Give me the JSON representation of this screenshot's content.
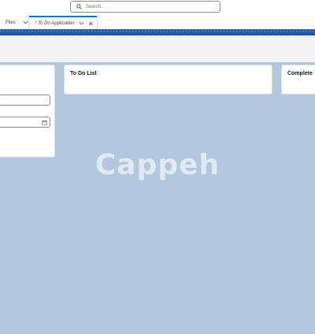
{
  "header": {
    "search_placeholder": "Search..."
  },
  "tabs": [
    {
      "label": "Files"
    },
    {
      "label": "* To Do Application"
    }
  ],
  "cards": {
    "todo_title": "To Do List",
    "complete_title": "Complete"
  },
  "watermark": "Cappeh",
  "colors": {
    "background": "#b3c8df",
    "brand_strip": "#2c66b4",
    "active_tab": "#0176d3"
  }
}
